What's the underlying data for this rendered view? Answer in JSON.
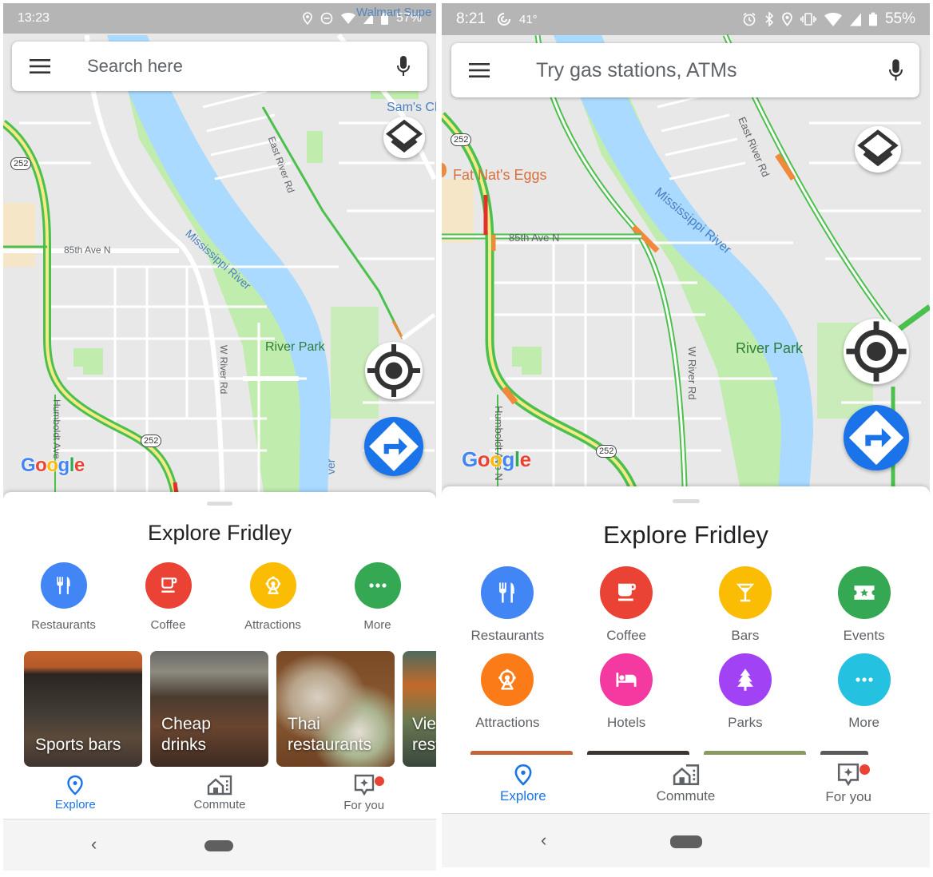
{
  "phones": [
    {
      "status_bar": {
        "time": "13:23",
        "overlay_text": "Walmart Supe",
        "battery": "57%",
        "icons": [
          "location-icon",
          "do-not-disturb-icon",
          "wifi-icon",
          "cell-signal-icon",
          "battery-icon"
        ]
      },
      "search": {
        "placeholder": "Search here",
        "value": ""
      },
      "map_labels": {
        "river": "Mississippi River",
        "avenue": "85th Ave N",
        "east_river_rd": "East River Rd",
        "w_river_rd": "W River Rd",
        "humboldt": "Humboldt Ave",
        "park": "River Park",
        "poi": "Sam's Cl",
        "shield_1": "252",
        "shield_2": "252",
        "river_bottom": "ver"
      },
      "go_label": "GO",
      "google_logo": [
        "G",
        "o",
        "o",
        "g",
        "l",
        "e"
      ],
      "sheet": {
        "title": "Explore Fridley",
        "categories": [
          {
            "label": "Restaurants",
            "icon": "restaurant-icon",
            "color": "#4285f4"
          },
          {
            "label": "Coffee",
            "icon": "coffee-icon",
            "color": "#ea4335"
          },
          {
            "label": "Attractions",
            "icon": "ferris-wheel-icon",
            "color": "#fbbc04"
          },
          {
            "label": "More",
            "icon": "more-icon",
            "color": "#34a853"
          }
        ],
        "cards": [
          {
            "label": "Sports bars"
          },
          {
            "label": "Cheap drinks"
          },
          {
            "label": "Thai restaurants"
          },
          {
            "label": "Vietnamese restaurants"
          }
        ]
      },
      "nav": [
        {
          "label": "Explore",
          "icon": "explore-pin-icon",
          "active": true
        },
        {
          "label": "Commute",
          "icon": "commute-icon",
          "active": false
        },
        {
          "label": "For you",
          "icon": "for-you-icon",
          "active": false,
          "badge": true
        }
      ],
      "system_nav": {
        "back": "‹"
      }
    },
    {
      "status_bar": {
        "time": "8:21",
        "temperature": "41°",
        "battery": "55%",
        "icons": [
          "weather-icon",
          "alarm-icon",
          "bluetooth-icon",
          "location-icon",
          "vibrate-icon",
          "wifi-icon",
          "cell-signal-icon",
          "battery-icon"
        ]
      },
      "search": {
        "placeholder": "Try gas stations, ATMs",
        "value": ""
      },
      "map_labels": {
        "river": "Mississippi River",
        "avenue": "85th Ave N",
        "east_river_rd": "East River Rd",
        "w_river_rd": "W River Rd",
        "humboldt": "Humboldt Ave N",
        "park": "River Park",
        "poi": "Fat Nat's Eggs",
        "shield_1": "252",
        "shield_2": "252"
      },
      "go_label": "GO",
      "google_logo": [
        "G",
        "o",
        "o",
        "g",
        "l",
        "e"
      ],
      "sheet": {
        "title": "Explore Fridley",
        "categories": [
          {
            "label": "Restaurants",
            "icon": "restaurant-icon",
            "color": "#4285f4"
          },
          {
            "label": "Coffee",
            "icon": "coffee-icon",
            "color": "#ea4335"
          },
          {
            "label": "Bars",
            "icon": "cocktail-icon",
            "color": "#fbbc04"
          },
          {
            "label": "Events",
            "icon": "ticket-star-icon",
            "color": "#34a853"
          },
          {
            "label": "Attractions",
            "icon": "ferris-wheel-icon",
            "color": "#fa7b17"
          },
          {
            "label": "Hotels",
            "icon": "bed-icon",
            "color": "#f439a0"
          },
          {
            "label": "Parks",
            "icon": "tree-icon",
            "color": "#a142f4"
          },
          {
            "label": "More",
            "icon": "more-icon",
            "color": "#24c1e0"
          }
        ]
      },
      "nav": [
        {
          "label": "Explore",
          "icon": "explore-pin-icon",
          "active": true
        },
        {
          "label": "Commute",
          "icon": "commute-icon",
          "active": false
        },
        {
          "label": "For you",
          "icon": "for-you-icon",
          "active": false,
          "badge": true
        }
      ],
      "system_nav": {
        "back": "‹"
      }
    }
  ],
  "colors": {
    "accent_blue": "#1a73e8",
    "map_bg": "#e8e8e8",
    "water": "#aadaff",
    "park": "#c0ecae",
    "traffic_green": "#4cc04c",
    "traffic_orange": "#f08a3a",
    "traffic_red": "#e0312a",
    "badge_red": "#ea4335"
  }
}
